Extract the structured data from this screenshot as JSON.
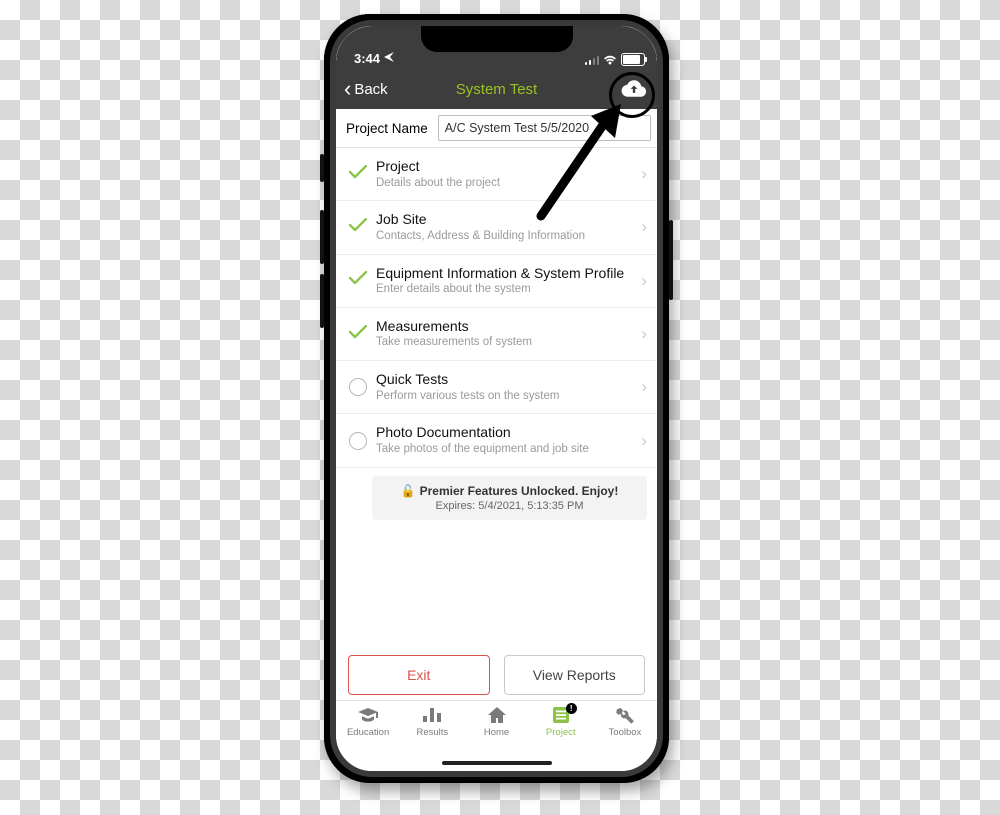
{
  "status": {
    "time": "3:44"
  },
  "nav": {
    "back": "Back",
    "title": "System Test"
  },
  "project": {
    "label": "Project Name",
    "value": "A/C System Test 5/5/2020"
  },
  "rows": [
    {
      "title": "Project",
      "sub": "Details about the project",
      "done": true
    },
    {
      "title": "Job Site",
      "sub": "Contacts, Address & Building Information",
      "done": true
    },
    {
      "title": "Equipment Information & System Profile",
      "sub": "Enter details about the system",
      "done": true
    },
    {
      "title": "Measurements",
      "sub": "Take measurements of system",
      "done": true
    },
    {
      "title": "Quick Tests",
      "sub": "Perform various tests on the system",
      "done": false
    },
    {
      "title": "Photo Documentation",
      "sub": "Take photos of the equipment and job site",
      "done": false
    }
  ],
  "banner": {
    "line1": "Premier Features Unlocked. Enjoy!",
    "line2": "Expires: 5/4/2021, 5:13:35 PM"
  },
  "buttons": {
    "exit": "Exit",
    "view": "View Reports"
  },
  "tabs": [
    {
      "label": "Education"
    },
    {
      "label": "Results"
    },
    {
      "label": "Home"
    },
    {
      "label": "Project"
    },
    {
      "label": "Toolbox"
    }
  ]
}
